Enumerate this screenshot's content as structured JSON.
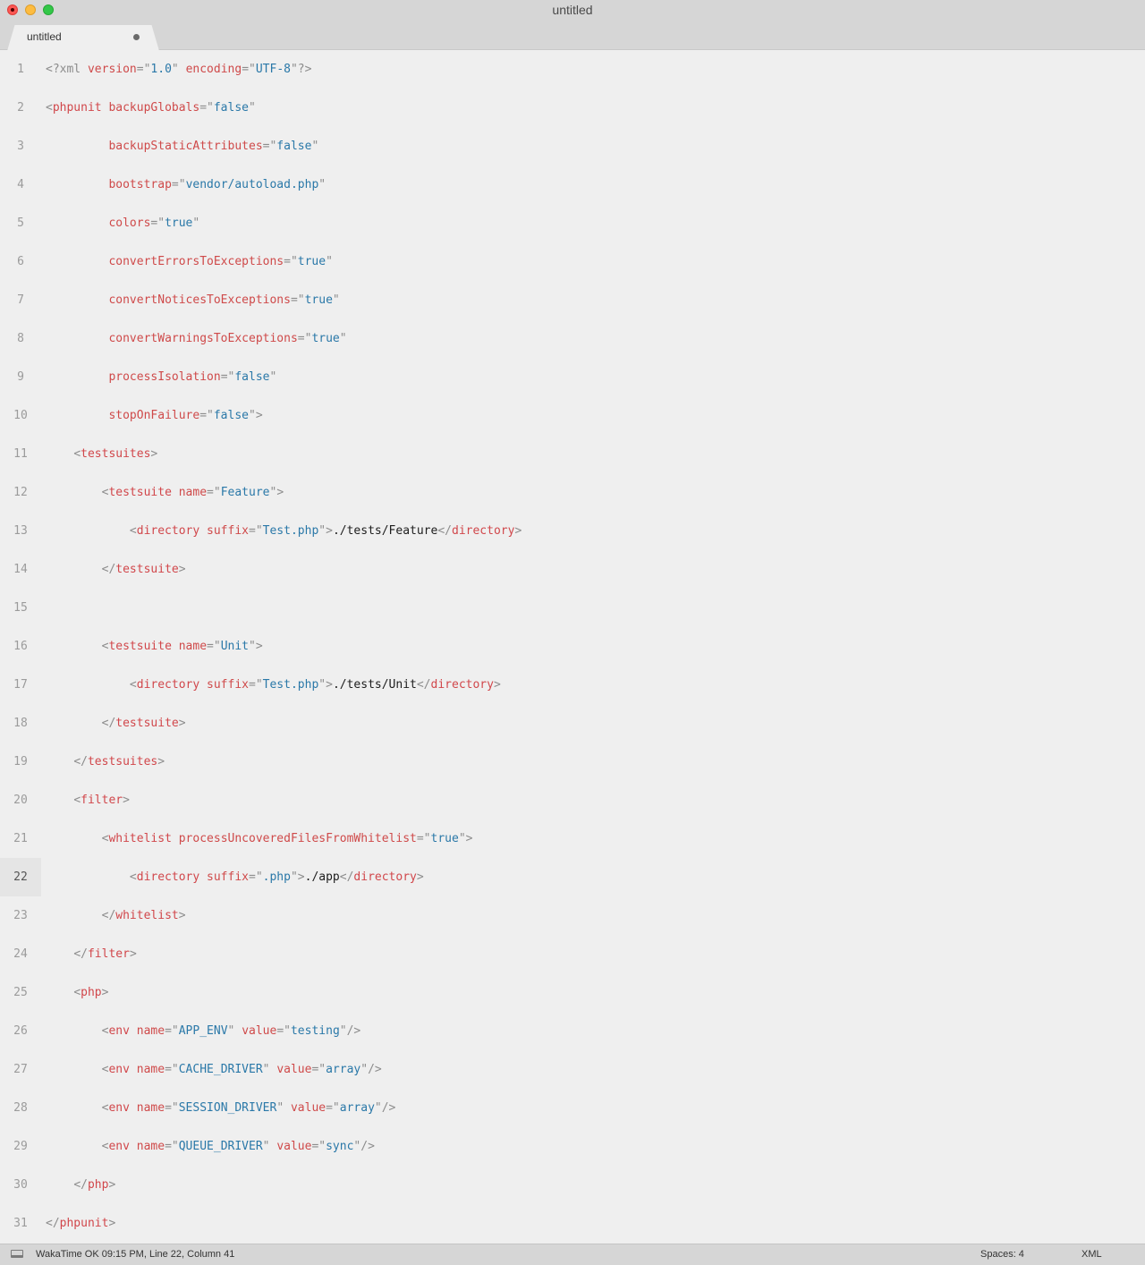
{
  "window": {
    "title": "untitled"
  },
  "tab": {
    "label": "untitled"
  },
  "editor": {
    "current_line": 22,
    "lines": [
      [
        [
          "p",
          "<?xml "
        ],
        [
          "a",
          "version"
        ],
        [
          "p",
          "=\""
        ],
        [
          "v",
          "1.0"
        ],
        [
          "p",
          "\" "
        ],
        [
          "a",
          "encoding"
        ],
        [
          "p",
          "=\""
        ],
        [
          "v",
          "UTF-8"
        ],
        [
          "p",
          "\"?>"
        ]
      ],
      [
        [
          "p",
          "<"
        ],
        [
          "t",
          "phpunit"
        ],
        [
          "x",
          " "
        ],
        [
          "a",
          "backupGlobals"
        ],
        [
          "p",
          "=\""
        ],
        [
          "v",
          "false"
        ],
        [
          "p",
          "\""
        ]
      ],
      [
        [
          "x",
          "         "
        ],
        [
          "a",
          "backupStaticAttributes"
        ],
        [
          "p",
          "=\""
        ],
        [
          "v",
          "false"
        ],
        [
          "p",
          "\""
        ]
      ],
      [
        [
          "x",
          "         "
        ],
        [
          "a",
          "bootstrap"
        ],
        [
          "p",
          "=\""
        ],
        [
          "v",
          "vendor/autoload.php"
        ],
        [
          "p",
          "\""
        ]
      ],
      [
        [
          "x",
          "         "
        ],
        [
          "a",
          "colors"
        ],
        [
          "p",
          "=\""
        ],
        [
          "v",
          "true"
        ],
        [
          "p",
          "\""
        ]
      ],
      [
        [
          "x",
          "         "
        ],
        [
          "a",
          "convertErrorsToExceptions"
        ],
        [
          "p",
          "=\""
        ],
        [
          "v",
          "true"
        ],
        [
          "p",
          "\""
        ]
      ],
      [
        [
          "x",
          "         "
        ],
        [
          "a",
          "convertNoticesToExceptions"
        ],
        [
          "p",
          "=\""
        ],
        [
          "v",
          "true"
        ],
        [
          "p",
          "\""
        ]
      ],
      [
        [
          "x",
          "         "
        ],
        [
          "a",
          "convertWarningsToExceptions"
        ],
        [
          "p",
          "=\""
        ],
        [
          "v",
          "true"
        ],
        [
          "p",
          "\""
        ]
      ],
      [
        [
          "x",
          "         "
        ],
        [
          "a",
          "processIsolation"
        ],
        [
          "p",
          "=\""
        ],
        [
          "v",
          "false"
        ],
        [
          "p",
          "\""
        ]
      ],
      [
        [
          "x",
          "         "
        ],
        [
          "a",
          "stopOnFailure"
        ],
        [
          "p",
          "=\""
        ],
        [
          "v",
          "false"
        ],
        [
          "p",
          "\">"
        ]
      ],
      [
        [
          "x",
          "    "
        ],
        [
          "p",
          "<"
        ],
        [
          "t",
          "testsuites"
        ],
        [
          "p",
          ">"
        ]
      ],
      [
        [
          "x",
          "        "
        ],
        [
          "p",
          "<"
        ],
        [
          "t",
          "testsuite"
        ],
        [
          "x",
          " "
        ],
        [
          "a",
          "name"
        ],
        [
          "p",
          "=\""
        ],
        [
          "v",
          "Feature"
        ],
        [
          "p",
          "\">"
        ]
      ],
      [
        [
          "x",
          "            "
        ],
        [
          "p",
          "<"
        ],
        [
          "t",
          "directory"
        ],
        [
          "x",
          " "
        ],
        [
          "a",
          "suffix"
        ],
        [
          "p",
          "=\""
        ],
        [
          "v",
          "Test.php"
        ],
        [
          "p",
          "\">"
        ],
        [
          "x",
          "./tests/Feature"
        ],
        [
          "p",
          "</"
        ],
        [
          "t",
          "directory"
        ],
        [
          "p",
          ">"
        ]
      ],
      [
        [
          "x",
          "        "
        ],
        [
          "p",
          "</"
        ],
        [
          "t",
          "testsuite"
        ],
        [
          "p",
          ">"
        ]
      ],
      [],
      [
        [
          "x",
          "        "
        ],
        [
          "p",
          "<"
        ],
        [
          "t",
          "testsuite"
        ],
        [
          "x",
          " "
        ],
        [
          "a",
          "name"
        ],
        [
          "p",
          "=\""
        ],
        [
          "v",
          "Unit"
        ],
        [
          "p",
          "\">"
        ]
      ],
      [
        [
          "x",
          "            "
        ],
        [
          "p",
          "<"
        ],
        [
          "t",
          "directory"
        ],
        [
          "x",
          " "
        ],
        [
          "a",
          "suffix"
        ],
        [
          "p",
          "=\""
        ],
        [
          "v",
          "Test.php"
        ],
        [
          "p",
          "\">"
        ],
        [
          "x",
          "./tests/Unit"
        ],
        [
          "p",
          "</"
        ],
        [
          "t",
          "directory"
        ],
        [
          "p",
          ">"
        ]
      ],
      [
        [
          "x",
          "        "
        ],
        [
          "p",
          "</"
        ],
        [
          "t",
          "testsuite"
        ],
        [
          "p",
          ">"
        ]
      ],
      [
        [
          "x",
          "    "
        ],
        [
          "p",
          "</"
        ],
        [
          "t",
          "testsuites"
        ],
        [
          "p",
          ">"
        ]
      ],
      [
        [
          "x",
          "    "
        ],
        [
          "p",
          "<"
        ],
        [
          "t",
          "filter"
        ],
        [
          "p",
          ">"
        ]
      ],
      [
        [
          "x",
          "        "
        ],
        [
          "p",
          "<"
        ],
        [
          "t",
          "whitelist"
        ],
        [
          "x",
          " "
        ],
        [
          "a",
          "processUncoveredFilesFromWhitelist"
        ],
        [
          "p",
          "=\""
        ],
        [
          "v",
          "true"
        ],
        [
          "p",
          "\">"
        ]
      ],
      [
        [
          "x",
          "            "
        ],
        [
          "p",
          "<"
        ],
        [
          "t",
          "directory"
        ],
        [
          "x",
          " "
        ],
        [
          "a",
          "suffix"
        ],
        [
          "p",
          "=\""
        ],
        [
          "v",
          ".php"
        ],
        [
          "p",
          "\">"
        ],
        [
          "x",
          "./app"
        ],
        [
          "p",
          "</"
        ],
        [
          "t",
          "directory"
        ],
        [
          "p",
          ">"
        ]
      ],
      [
        [
          "x",
          "        "
        ],
        [
          "p",
          "</"
        ],
        [
          "t",
          "whitelist"
        ],
        [
          "p",
          ">"
        ]
      ],
      [
        [
          "x",
          "    "
        ],
        [
          "p",
          "</"
        ],
        [
          "t",
          "filter"
        ],
        [
          "p",
          ">"
        ]
      ],
      [
        [
          "x",
          "    "
        ],
        [
          "p",
          "<"
        ],
        [
          "t",
          "php"
        ],
        [
          "p",
          ">"
        ]
      ],
      [
        [
          "x",
          "        "
        ],
        [
          "p",
          "<"
        ],
        [
          "t",
          "env"
        ],
        [
          "x",
          " "
        ],
        [
          "a",
          "name"
        ],
        [
          "p",
          "=\""
        ],
        [
          "v",
          "APP_ENV"
        ],
        [
          "p",
          "\" "
        ],
        [
          "a",
          "value"
        ],
        [
          "p",
          "=\""
        ],
        [
          "v",
          "testing"
        ],
        [
          "p",
          "\"/>"
        ]
      ],
      [
        [
          "x",
          "        "
        ],
        [
          "p",
          "<"
        ],
        [
          "t",
          "env"
        ],
        [
          "x",
          " "
        ],
        [
          "a",
          "name"
        ],
        [
          "p",
          "=\""
        ],
        [
          "v",
          "CACHE_DRIVER"
        ],
        [
          "p",
          "\" "
        ],
        [
          "a",
          "value"
        ],
        [
          "p",
          "=\""
        ],
        [
          "v",
          "array"
        ],
        [
          "p",
          "\"/>"
        ]
      ],
      [
        [
          "x",
          "        "
        ],
        [
          "p",
          "<"
        ],
        [
          "t",
          "env"
        ],
        [
          "x",
          " "
        ],
        [
          "a",
          "name"
        ],
        [
          "p",
          "=\""
        ],
        [
          "v",
          "SESSION_DRIVER"
        ],
        [
          "p",
          "\" "
        ],
        [
          "a",
          "value"
        ],
        [
          "p",
          "=\""
        ],
        [
          "v",
          "array"
        ],
        [
          "p",
          "\"/>"
        ]
      ],
      [
        [
          "x",
          "        "
        ],
        [
          "p",
          "<"
        ],
        [
          "t",
          "env"
        ],
        [
          "x",
          " "
        ],
        [
          "a",
          "name"
        ],
        [
          "p",
          "=\""
        ],
        [
          "v",
          "QUEUE_DRIVER"
        ],
        [
          "p",
          "\" "
        ],
        [
          "a",
          "value"
        ],
        [
          "p",
          "=\""
        ],
        [
          "v",
          "sync"
        ],
        [
          "p",
          "\"/>"
        ]
      ],
      [
        [
          "x",
          "    "
        ],
        [
          "p",
          "</"
        ],
        [
          "t",
          "php"
        ],
        [
          "p",
          ">"
        ]
      ],
      [
        [
          "p",
          "</"
        ],
        [
          "t",
          "phpunit"
        ],
        [
          "p",
          ">"
        ]
      ]
    ]
  },
  "statusbar": {
    "info": "WakaTime OK 09:15 PM, Line 22, Column 41",
    "spaces": "Spaces: 4",
    "syntax": "XML"
  }
}
